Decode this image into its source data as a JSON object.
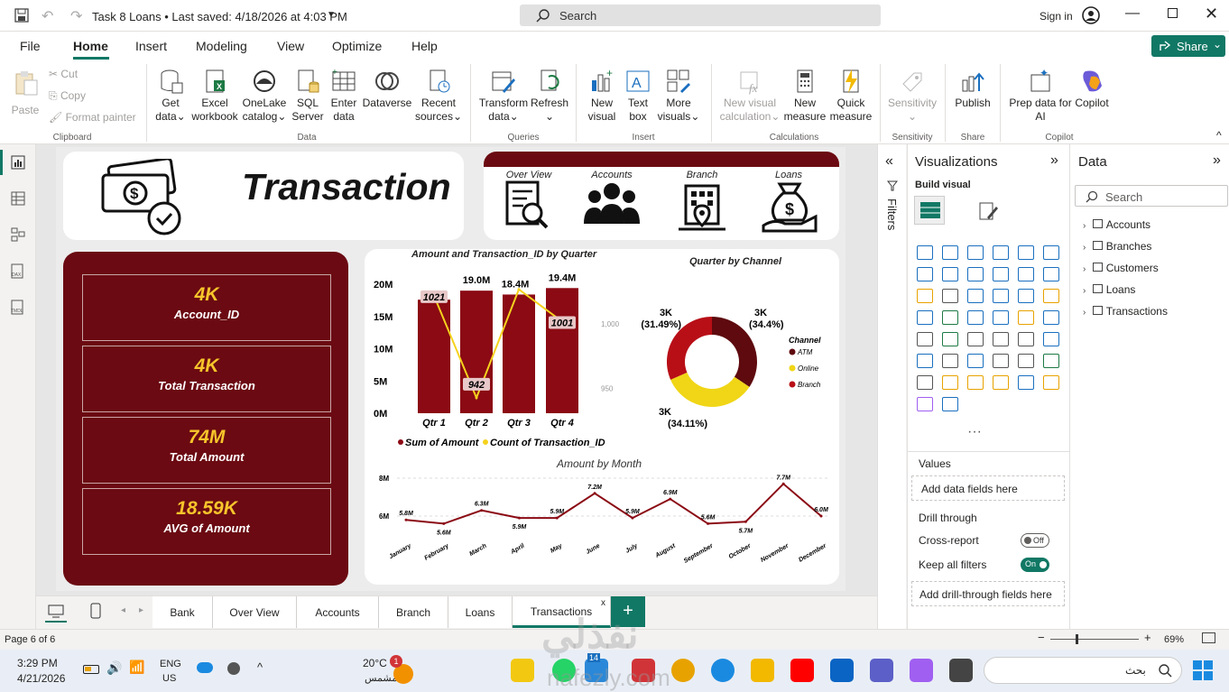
{
  "titlebar": {
    "doc_title": "Task 8 Loans • Last saved: 4/18/2026 at 4:03 PM",
    "search_placeholder": "Search",
    "signin": "Sign in"
  },
  "menu": {
    "items": [
      "File",
      "Home",
      "Insert",
      "Modeling",
      "View",
      "Optimize",
      "Help"
    ],
    "share": "Share"
  },
  "ribbon": {
    "clipboard": {
      "paste": "Paste",
      "cut": "Cut",
      "copy": "Copy",
      "format": "Format painter",
      "group": "Clipboard"
    },
    "data": {
      "get": [
        "Get",
        "data"
      ],
      "excel": [
        "Excel",
        "workbook"
      ],
      "onelake": [
        "OneLake",
        "catalog"
      ],
      "sql": [
        "SQL",
        "Server"
      ],
      "enter": [
        "Enter",
        "data"
      ],
      "dataverse": [
        "Dataverse",
        ""
      ],
      "recent": [
        "Recent",
        "sources"
      ],
      "group": "Data"
    },
    "queries": {
      "transform": [
        "Transform",
        "data"
      ],
      "refresh": [
        "Refresh",
        ""
      ],
      "group": "Queries"
    },
    "insert": {
      "newvisual": [
        "New",
        "visual"
      ],
      "textbox": [
        "Text",
        "box"
      ],
      "morevisuals": [
        "More",
        "visuals"
      ],
      "group": "Insert"
    },
    "calc": {
      "newvc": [
        "New visual",
        "calculation"
      ],
      "newmeasure": [
        "New",
        "measure"
      ],
      "quickmeasure": [
        "Quick",
        "measure"
      ],
      "group": "Calculations"
    },
    "sens": {
      "label": [
        "Sensitivity",
        ""
      ],
      "group": "Sensitivity"
    },
    "share": {
      "publish": "Publish",
      "group": "Share"
    },
    "copilot": {
      "prep": [
        "Prep data for",
        "AI"
      ],
      "copilot": "Copilot",
      "group": "Copilot"
    }
  },
  "report": {
    "title": "Transaction",
    "nav": [
      "Over View",
      "Accounts",
      "Branch",
      "Loans"
    ],
    "kpis": [
      {
        "value": "4K",
        "label": "Account_ID"
      },
      {
        "value": "4K",
        "label": "Total Transaction"
      },
      {
        "value": "74M",
        "label": "Total Amount"
      },
      {
        "value": "18.59K",
        "label": "AVG of Amount"
      }
    ]
  },
  "chart_data": [
    {
      "type": "bar",
      "title": "Amount and Transaction_ID by Quarter",
      "categories": [
        "Qtr 1",
        "Qtr 2",
        "Qtr 3",
        "Qtr 4"
      ],
      "series": [
        {
          "name": "Sum of Amount",
          "values": [
            17.6,
            19.0,
            18.4,
            19.4
          ],
          "labels": [
            "17.6M",
            "19.0M",
            "18.4M",
            "19.4M"
          ]
        },
        {
          "name": "Count of Transaction_ID",
          "values": [
            1021,
            942,
            1026,
            1001
          ],
          "labels": [
            "1021",
            "942",
            "",
            "1001"
          ]
        }
      ],
      "y_ticks": [
        "20M",
        "15M",
        "10M",
        "5M",
        "0M"
      ],
      "ylim": [
        0,
        20
      ],
      "y2_ticks": [
        "1,000",
        "950"
      ],
      "y2lim": [
        930,
        1030
      ],
      "colors": {
        "bar": "#8b0a14",
        "line": "#f5d21d"
      }
    },
    {
      "type": "pie",
      "title": "Quarter by Channel",
      "legend_title": "Channel",
      "slices": [
        {
          "name": "ATM",
          "value": 34.4,
          "label": "3K",
          "pct": "(34.4%)",
          "color": "#5e0a0f"
        },
        {
          "name": "Online",
          "value": 34.11,
          "label": "3K",
          "pct": "(34.11%)",
          "color": "#f0d616"
        },
        {
          "name": "Branch",
          "value": 31.49,
          "label": "3K",
          "pct": "(31.49%)",
          "color": "#b80f17"
        }
      ]
    },
    {
      "type": "line",
      "title": "Amount by Month",
      "categories": [
        "January",
        "February",
        "March",
        "April",
        "May",
        "June",
        "July",
        "August",
        "September",
        "October",
        "November",
        "December"
      ],
      "values": [
        5.8,
        5.6,
        6.3,
        5.9,
        5.9,
        7.2,
        5.9,
        6.9,
        5.6,
        5.7,
        7.7,
        6.0
      ],
      "labels": [
        "5.8M",
        "5.6M",
        "6.3M",
        "5.9M",
        "5.9M",
        "7.2M",
        "5.9M",
        "6.9M",
        "5.6M",
        "5.7M",
        "7.7M",
        "6.0M"
      ],
      "y_ticks": [
        "8M",
        "6M"
      ],
      "ylim": [
        5,
        8
      ],
      "color": "#8b0a14"
    }
  ],
  "viz": {
    "title": "Visualizations",
    "build": "Build visual",
    "values": "Values",
    "add": "Add data fields here",
    "drill": "Drill through",
    "cross": "Cross-report",
    "cross_state": "Off",
    "keep": "Keep all filters",
    "keep_state": "On",
    "add_drill": "Add drill-through fields here"
  },
  "filters": "Filters",
  "datapane": {
    "title": "Data",
    "search": "Search",
    "tables": [
      "Accounts",
      "Branches",
      "Customers",
      "Loans",
      "Transactions"
    ]
  },
  "tabs": [
    "Bank",
    "Over View",
    "Accounts",
    "Branch",
    "Loans",
    "Transactions"
  ],
  "status": {
    "page": "Page 6 of 6",
    "zoom": "69%"
  },
  "taskbar": {
    "time": "3:29 PM",
    "date": "4/21/2026",
    "lang1": "ENG",
    "lang2": "US",
    "temp": "20°C",
    "weather": "مشمس",
    "search": "بحث",
    "badge": "14",
    "notif": "1"
  },
  "watermark": {
    "top": "نفذلي",
    "bottom": "nafezly.com"
  }
}
